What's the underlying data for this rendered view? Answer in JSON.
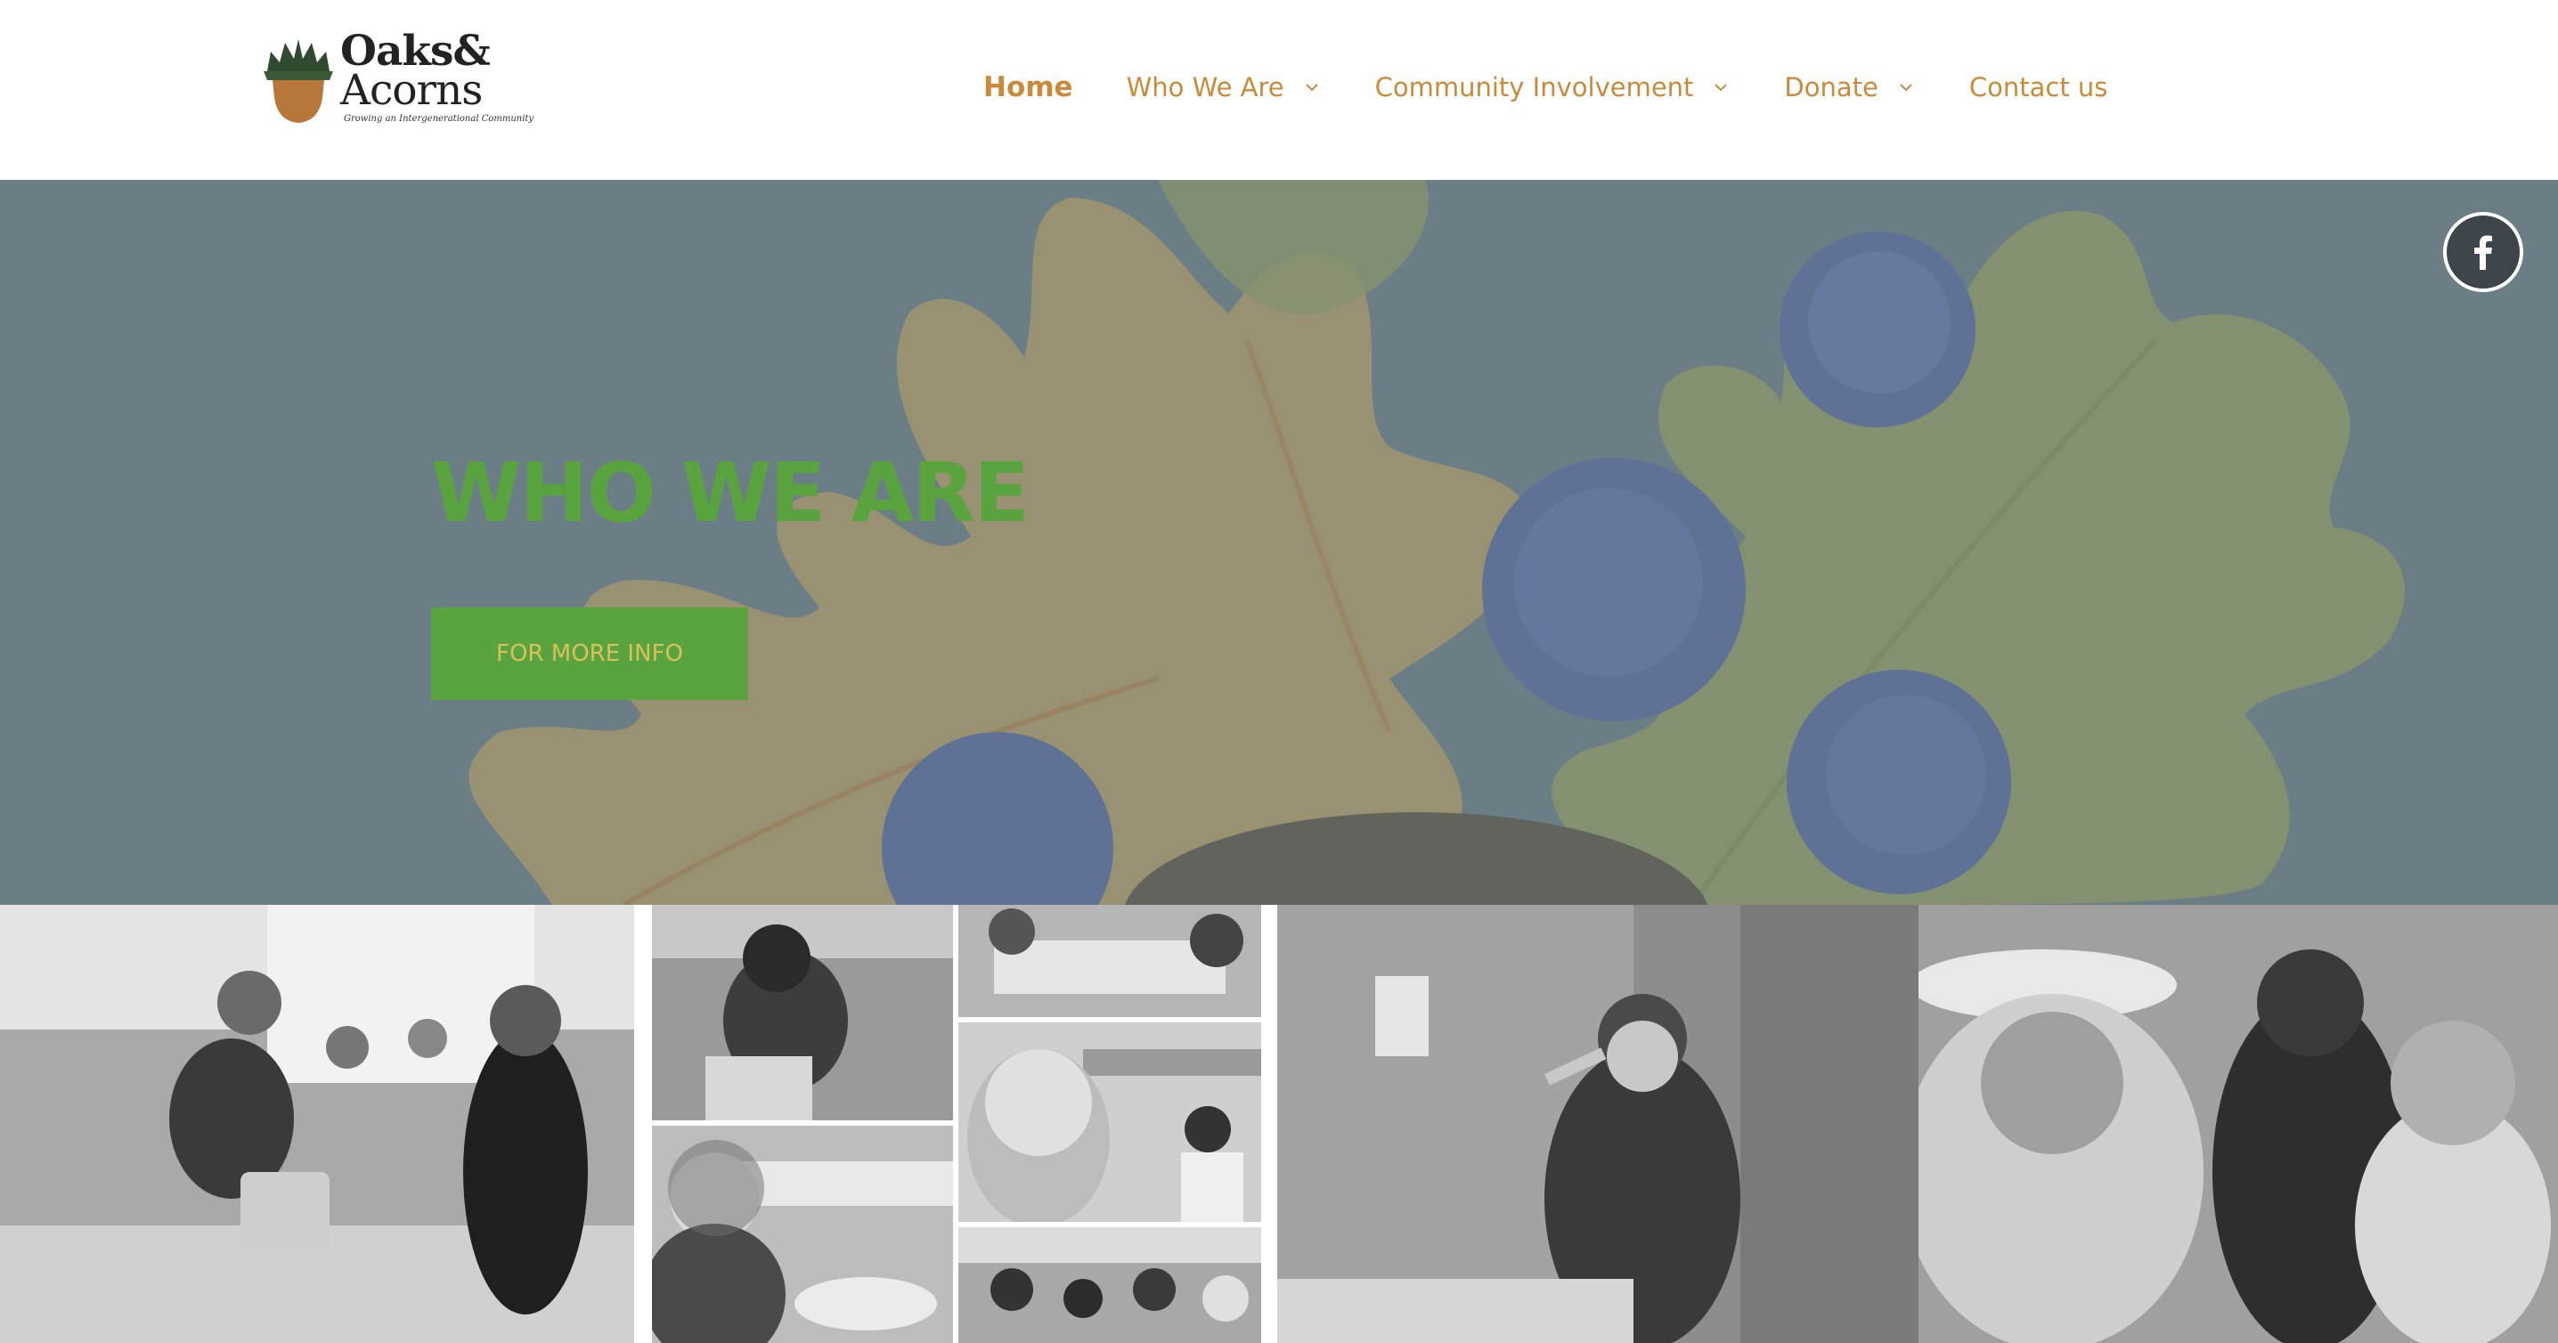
{
  "brand": {
    "name_line1": "Oaks&",
    "name_line2": "Acorns",
    "tagline": "Growing an Intergenerational Community",
    "colors": {
      "accent": "#c98a3a",
      "green": "#5aa43f",
      "button_text": "#d8c05a"
    }
  },
  "nav": {
    "items": [
      {
        "label": "Home",
        "active": true,
        "has_dropdown": false
      },
      {
        "label": "Who We Are",
        "active": false,
        "has_dropdown": true
      },
      {
        "label": "Community Involvement",
        "active": false,
        "has_dropdown": true
      },
      {
        "label": "Donate",
        "active": false,
        "has_dropdown": true
      },
      {
        "label": "Contact us",
        "active": false,
        "has_dropdown": false
      }
    ]
  },
  "hero": {
    "title": "WHO WE ARE",
    "button_label": "FOR MORE INFO",
    "social_icon": "facebook-icon"
  },
  "gallery": {
    "photos": [
      "cooking-activity-photo",
      "table-activity-photo",
      "art-table-photo",
      "smiling-woman-photo",
      "elder-and-child-photo",
      "group-table-photo",
      "speaker-with-microphone-photo",
      "elder-and-girl-photo"
    ]
  }
}
